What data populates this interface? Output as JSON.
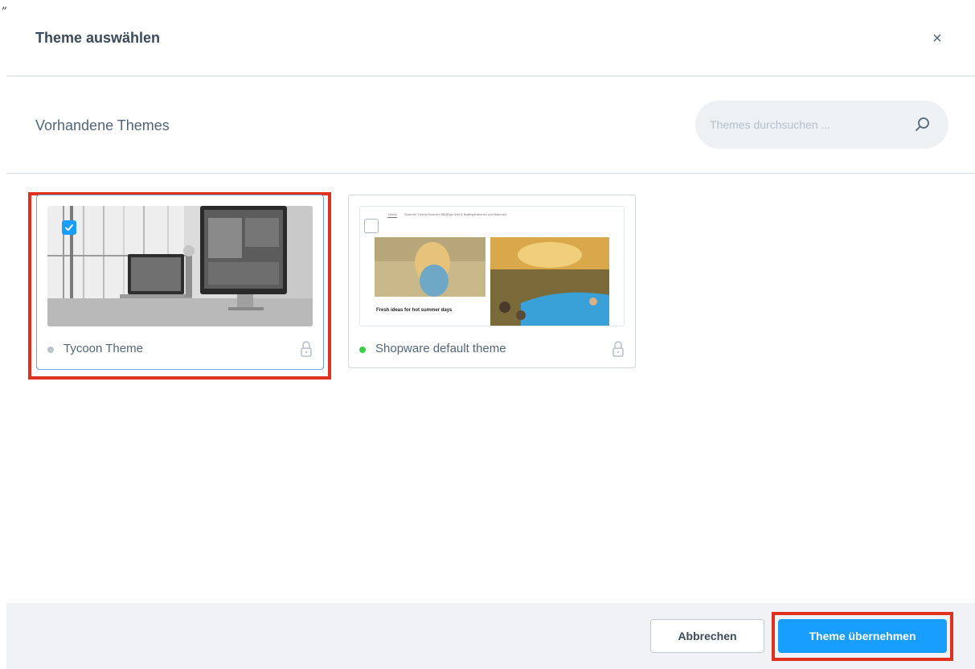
{
  "corner_mark": "„",
  "modal": {
    "title": "Theme auswählen",
    "close_label": "×"
  },
  "toolbar": {
    "subtitle": "Vorhandene Themes",
    "search_placeholder": "Themes durchsuchen ...",
    "search_value": ""
  },
  "themes": [
    {
      "name": "Tycoon Theme",
      "status_color": "#b8c4d0",
      "selected": true,
      "highlighted": true,
      "locked": true,
      "thumb_icon": "desk-workspace-image"
    },
    {
      "name": "Shopware default theme",
      "status_color": "#37d046",
      "selected": false,
      "highlighted": false,
      "locked": true,
      "thumb_icon": "storefront-preview-image",
      "preview": {
        "nav_items": [
          "Home",
          "Summer Trends",
          "Summer BBQ",
          "Sale Wel & Bad",
          "Inspirationen und Aktionen"
        ],
        "headline": "Fresh ideas for hot summer days"
      }
    }
  ],
  "footer": {
    "cancel_label": "Abbrechen",
    "apply_label": "Theme übernehmen",
    "apply_highlighted": true
  },
  "colors": {
    "accent": "#189eff",
    "highlight": "#e0301e",
    "border": "#d1d9e0",
    "text": "#52667a"
  }
}
